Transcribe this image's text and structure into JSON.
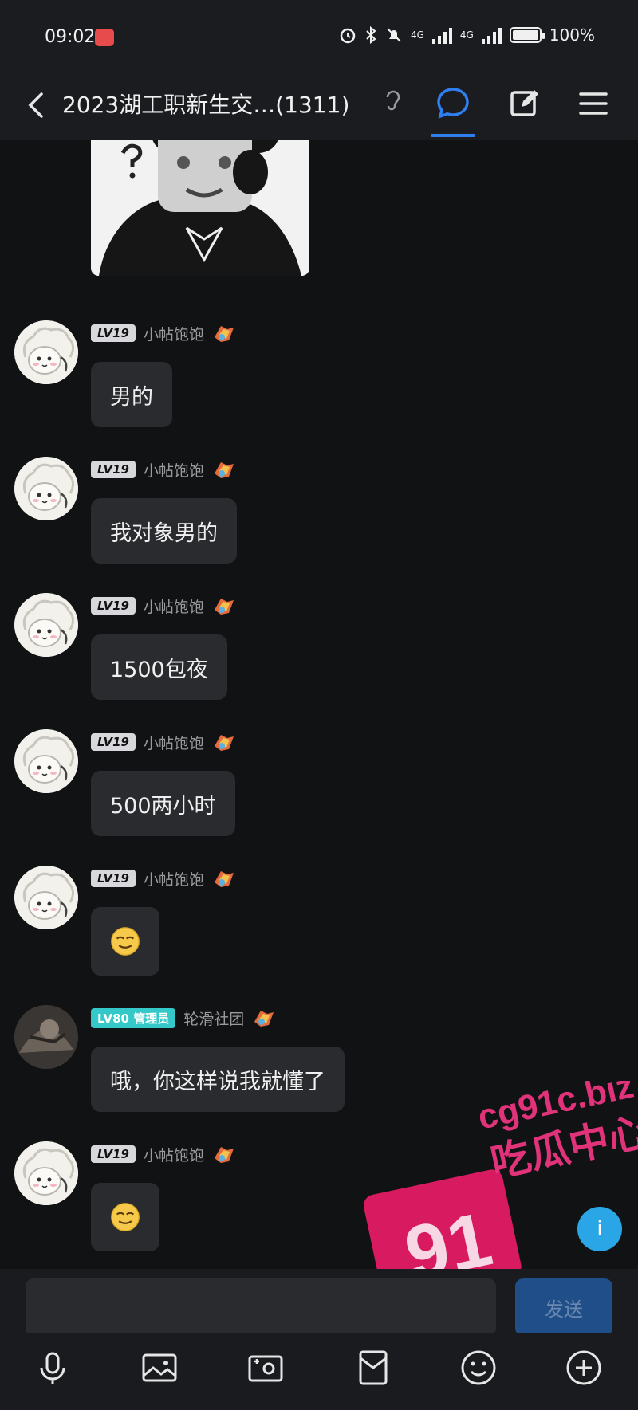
{
  "status_bar": {
    "time": "09:02",
    "network_1": "4G",
    "network_2": "4G",
    "battery": "100%"
  },
  "header": {
    "title": "2023湖工职新生交…(1311)"
  },
  "messages": [
    {
      "level": "LV19",
      "name": "小帖饱饱",
      "text": "男的",
      "type": "text"
    },
    {
      "level": "LV19",
      "name": "小帖饱饱",
      "text": "我对象男的",
      "type": "text"
    },
    {
      "level": "LV19",
      "name": "小帖饱饱",
      "text": "1500包夜",
      "type": "text"
    },
    {
      "level": "LV19",
      "name": "小帖饱饱",
      "text": "500两小时",
      "type": "text"
    },
    {
      "level": "LV19",
      "name": "小帖饱饱",
      "type": "emoji",
      "emoji": "smirk-emoji"
    },
    {
      "level": "LV80",
      "role": "管理员",
      "name": "轮滑社团",
      "text": "哦，你这样说我就懂了",
      "type": "text"
    },
    {
      "level": "LV19",
      "name": "小帖饱饱",
      "type": "emoji",
      "emoji": "smirk-emoji"
    }
  ],
  "watermark": {
    "badge": "91",
    "domain": "cg91c.biz",
    "caption": "吃瓜中心"
  },
  "help_badge": "i",
  "composer": {
    "placeholder": "",
    "send_label": "发送"
  },
  "toolbar_icons": [
    "microphone-icon",
    "image-icon",
    "camera-icon",
    "red-packet-icon",
    "emoji-icon",
    "plus-icon"
  ],
  "colors": {
    "background": "#111214",
    "bubble": "#2a2b2e",
    "accent": "#2f7ff0",
    "admin_tag": "#35c8c8",
    "send_button": "#1f4e88",
    "watermark": "#d81b60"
  }
}
